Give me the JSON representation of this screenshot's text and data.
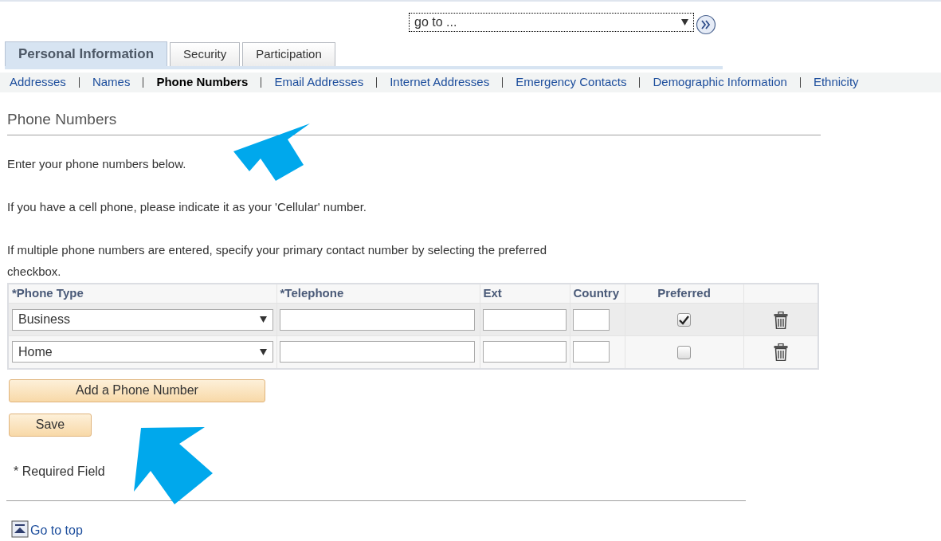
{
  "goto": {
    "value": "go to ..."
  },
  "tabs": [
    {
      "label": "Personal Information",
      "selected": true
    },
    {
      "label": "Security",
      "selected": false
    },
    {
      "label": "Participation",
      "selected": false
    }
  ],
  "subnav": [
    {
      "label": "Addresses",
      "selected": false
    },
    {
      "label": "Names",
      "selected": false
    },
    {
      "label": "Phone Numbers",
      "selected": true
    },
    {
      "label": "Email Addresses",
      "selected": false
    },
    {
      "label": "Internet Addresses",
      "selected": false
    },
    {
      "label": "Emergency Contacts",
      "selected": false
    },
    {
      "label": "Demographic Information",
      "selected": false
    },
    {
      "label": "Ethnicity",
      "selected": false
    }
  ],
  "heading": "Phone Numbers",
  "paragraphs": [
    "Enter your phone numbers below.",
    "If you have a cell phone, please indicate it as your 'Cellular' number.",
    "If multiple phone numbers are entered, specify your primary contact number by selecting the preferred checkbox."
  ],
  "table": {
    "columns": [
      "*Phone Type",
      "*Telephone",
      "Ext",
      "Country",
      "Preferred"
    ],
    "rows": [
      {
        "phone_type": "Business",
        "preferred": true
      },
      {
        "phone_type": "Home",
        "preferred": false
      }
    ]
  },
  "buttons": [
    "Add a Phone Number",
    "Save"
  ],
  "required_note": "* Required Field",
  "go_to_top": "Go to top"
}
